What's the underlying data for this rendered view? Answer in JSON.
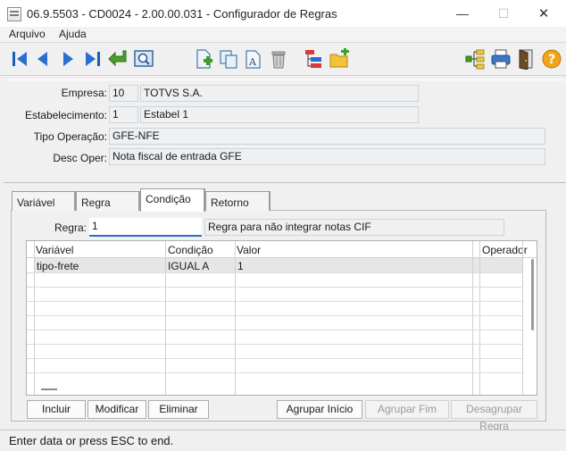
{
  "window": {
    "title": "06.9.5503 - CD0024 - 2.00.00.031 - Configurador de Regras",
    "minimize_glyph": "—",
    "maximize_glyph": "☐",
    "close_glyph": "✕"
  },
  "menu": {
    "items": [
      "Arquivo",
      "Ajuda"
    ]
  },
  "toolbar": {
    "icons": [
      "first-record-icon",
      "previous-record-icon",
      "next-record-icon",
      "last-record-icon",
      "goto-return-icon",
      "search-icon",
      "new-record-icon",
      "copy-record-icon",
      "edit-record-icon",
      "delete-trash-icon",
      "hierarchy-tree-icon",
      "new-folder-icon",
      "tree-structure-icon",
      "printer-icon",
      "exit-door-icon",
      "help-icon"
    ],
    "help_glyph": "?"
  },
  "header": {
    "empresa": {
      "label": "Empresa:",
      "code": "10",
      "name": "TOTVS S.A."
    },
    "estabelecimento": {
      "label": "Estabelecimento:",
      "code": "1",
      "name": "Estabel 1"
    },
    "tipo_operacao": {
      "label": "Tipo Operação:",
      "value": "GFE-NFE"
    },
    "desc_oper": {
      "label": "Desc Oper:",
      "value": "Nota fiscal de entrada GFE"
    }
  },
  "tabs": [
    {
      "label": "Variável",
      "active": false
    },
    {
      "label": "Regra",
      "active": false
    },
    {
      "label": "Condição",
      "active": true
    },
    {
      "label": "Retorno",
      "active": false
    }
  ],
  "regra": {
    "label": "Regra:",
    "value": "1",
    "description": "Regra para não integrar notas CIF"
  },
  "grid": {
    "columns": [
      "Variável",
      "Condição",
      "Valor",
      "Operador"
    ],
    "rows": [
      [
        "tipo-frete",
        "IGUAL A",
        "1",
        ""
      ]
    ]
  },
  "buttons": {
    "incluir": "Incluir",
    "modificar": "Modificar",
    "eliminar": "Eliminar",
    "agrupar_inicio": "Agrupar Início",
    "agrupar_fim": "Agrupar Fim",
    "desagrupar_regra": "Desagrupar Regra"
  },
  "status": {
    "message": "Enter data or press ESC to end."
  }
}
